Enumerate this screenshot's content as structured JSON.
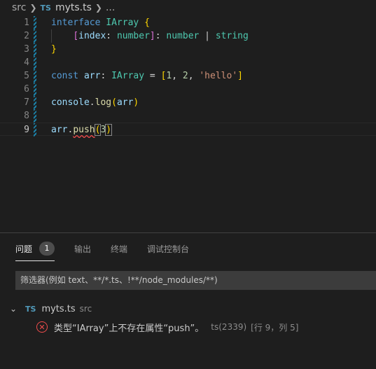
{
  "breadcrumb": {
    "folder": "src",
    "badge": "TS",
    "file": "myts.ts",
    "more": "..."
  },
  "editor": {
    "lines": [
      {
        "num": "1",
        "tokens": [
          [
            "kw",
            "interface"
          ],
          [
            "pl",
            " "
          ],
          [
            "ty",
            "IArray"
          ],
          [
            "pl",
            " "
          ],
          [
            "b1",
            "{"
          ]
        ]
      },
      {
        "num": "2",
        "tokens": [
          [
            "pl",
            "    "
          ],
          [
            "b2",
            "["
          ],
          [
            "va",
            "index"
          ],
          [
            "pl",
            ": "
          ],
          [
            "ty",
            "number"
          ],
          [
            "b2",
            "]"
          ],
          [
            "pl",
            ": "
          ],
          [
            "ty",
            "number"
          ],
          [
            "pl",
            " | "
          ],
          [
            "ty",
            "string"
          ]
        ]
      },
      {
        "num": "3",
        "tokens": [
          [
            "b1",
            "}"
          ]
        ]
      },
      {
        "num": "4",
        "tokens": []
      },
      {
        "num": "5",
        "tokens": [
          [
            "kw",
            "const"
          ],
          [
            "pl",
            " "
          ],
          [
            "va",
            "arr"
          ],
          [
            "pl",
            ": "
          ],
          [
            "ty",
            "IArray"
          ],
          [
            "pl",
            " = "
          ],
          [
            "b1",
            "["
          ],
          [
            "nu",
            "1"
          ],
          [
            "pl",
            ", "
          ],
          [
            "nu",
            "2"
          ],
          [
            "pl",
            ", "
          ],
          [
            "st",
            "'hello'"
          ],
          [
            "b1",
            "]"
          ]
        ]
      },
      {
        "num": "6",
        "tokens": []
      },
      {
        "num": "7",
        "tokens": [
          [
            "va",
            "console"
          ],
          [
            "pl",
            "."
          ],
          [
            "fn",
            "log"
          ],
          [
            "b1",
            "("
          ],
          [
            "va",
            "arr"
          ],
          [
            "b1",
            ")"
          ]
        ]
      },
      {
        "num": "8",
        "tokens": []
      },
      {
        "num": "9",
        "tokens": [
          [
            "va",
            "arr"
          ],
          [
            "pl",
            "."
          ],
          [
            "fn squiggle",
            "push"
          ],
          [
            "b1 bracket-hl",
            "("
          ],
          [
            "nu",
            "3"
          ],
          [
            "b1 bracket-hl",
            ")"
          ]
        ]
      }
    ]
  },
  "panel": {
    "tabs": [
      {
        "label": "问题",
        "badge": "1",
        "active": true
      },
      {
        "label": "输出"
      },
      {
        "label": "终端"
      },
      {
        "label": "调试控制台"
      }
    ],
    "filter_placeholder": "筛选器(例如 text、**/*.ts、!**/node_modules/**)",
    "file": {
      "chevron": "⌄",
      "badge": "TS",
      "name": "myts.ts",
      "dir": "src"
    },
    "problem": {
      "icon": "error-icon",
      "message": "类型“IArray”上不存在属性“push”。",
      "source": "ts(2339)",
      "position": "[行 9，列 5]"
    }
  },
  "colors": {
    "background": "#1e1e1e",
    "error": "#f14c4c",
    "ts_badge": "#519aba"
  }
}
